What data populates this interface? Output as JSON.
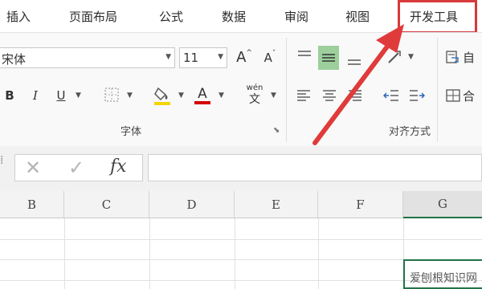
{
  "tabs": [
    "插入",
    "页面布局",
    "公式",
    "数据",
    "审阅",
    "视图",
    "开发工具"
  ],
  "font": {
    "name": "宋体",
    "size": "11",
    "grow_label": "A",
    "shrink_label": "A",
    "bold": "B",
    "italic": "I",
    "underline": "U",
    "font_color_label": "A",
    "phonetic_top": "wén",
    "phonetic_bottom": "文",
    "group_label": "字体"
  },
  "alignment": {
    "group_label": "对齐方式"
  },
  "partial": {
    "top_label": "自",
    "bottom_label": "合"
  },
  "formula_bar": {
    "fx": "fx",
    "value": ""
  },
  "columns": [
    "B",
    "C",
    "D",
    "E",
    "F",
    "G"
  ],
  "watermark": "爱刨根知识网",
  "colors": {
    "highlight_box": "#d63a3a",
    "arrow": "#e03b3b",
    "active_align": "#9ccf9c",
    "fill_yellow": "#f5d400",
    "font_red": "#d40000",
    "active_col": "#217346"
  }
}
